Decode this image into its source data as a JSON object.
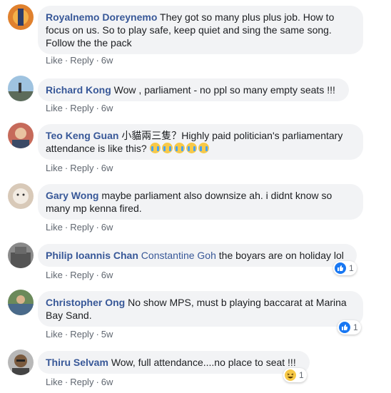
{
  "actions": {
    "like": "Like",
    "reply": "Reply",
    "sep": "·"
  },
  "colors": {
    "link": "#385898",
    "bubble": "#f2f3f5",
    "meta": "#606770",
    "like_blue": "#1877f2"
  },
  "comments": [
    {
      "author": "Royalnemo Doreynemo",
      "line1": "They got so many plus plus job. How to",
      "line2": "focus on us. So to play safe, keep quiet and sing the same song.",
      "line3": "Follow the the pack",
      "time": "6w"
    },
    {
      "author": "Richard Kong",
      "text": "Wow , parliament - no ppl so many empty seats !!!",
      "time": "6w"
    },
    {
      "author": "Teo Keng Guan",
      "line1": "小貓兩三隻？Highly paid politician's parliamentary",
      "line2": "attendance is like this?",
      "emoji_icon": "crying-laughing-emoji",
      "time": "6w"
    },
    {
      "author": "Gary Wong",
      "line1": "maybe parliament also downsize ah. i didnt know so",
      "line2": "many mp kenna fired.",
      "time": "6w"
    },
    {
      "author": "Philip Ioannis Chan",
      "mention": "Constantine Goh",
      "text": "the boyars are on holiday lol",
      "time": "6w",
      "reaction_icon": "like-icon",
      "reaction_count": "1"
    },
    {
      "author": "Christopher Ong",
      "line1": "No show MPS, must b playing baccarat at Marina",
      "line2": "Bay Sand.",
      "time": "5w",
      "reaction_icon": "like-icon",
      "reaction_count": "1"
    },
    {
      "author": "Thiru Selvam",
      "text": "Wow, full attendance....no place to seat !!!",
      "time": "6w",
      "reaction_icon": "haha-icon",
      "reaction_count": "1"
    }
  ]
}
